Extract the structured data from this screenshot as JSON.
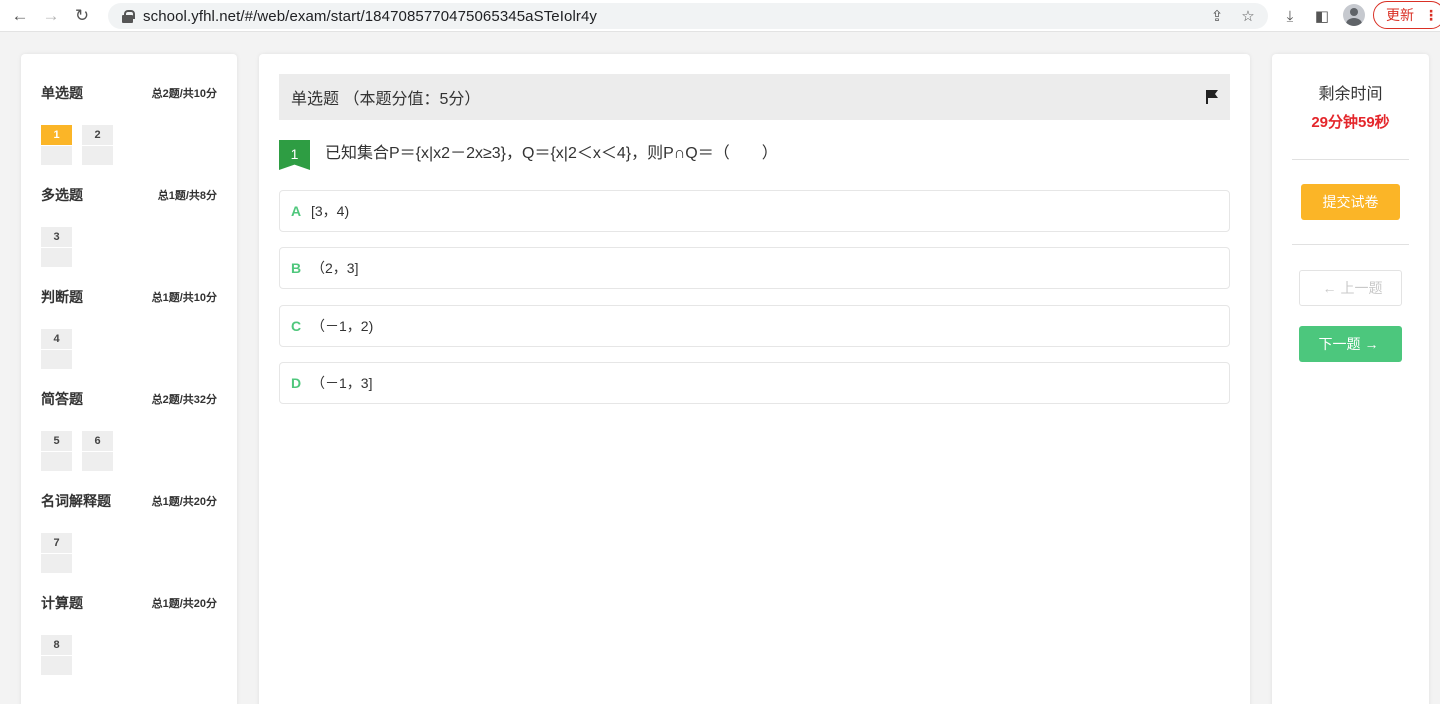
{
  "browser": {
    "url": "school.yfhl.net/#/web/exam/start/1847085770475065345aSTeIolr4y",
    "update_label": "更新",
    "menu_glyph": "⋮"
  },
  "sections": [
    {
      "title": "单选题",
      "summary": "总2题/共10分",
      "questions": [
        "1",
        "2"
      ],
      "active": "1"
    },
    {
      "title": "多选题",
      "summary": "总1题/共8分",
      "questions": [
        "3"
      ]
    },
    {
      "title": "判断题",
      "summary": "总1题/共10分",
      "questions": [
        "4"
      ]
    },
    {
      "title": "简答题",
      "summary": "总2题/共32分",
      "questions": [
        "5",
        "6"
      ]
    },
    {
      "title": "名词解释题",
      "summary": "总1题/共20分",
      "questions": [
        "7"
      ]
    },
    {
      "title": "计算题",
      "summary": "总1题/共20分",
      "questions": [
        "8"
      ]
    }
  ],
  "question": {
    "header": "单选题 （本题分值：5分）",
    "number": "1",
    "stem": "已知集合P＝{x|x2－2x≥3}，Q＝{x|2＜x＜4}，则P∩Q＝（　　）",
    "options": [
      {
        "letter": "A",
        "text": "[3，4)"
      },
      {
        "letter": "B",
        "text": "（2，3]"
      },
      {
        "letter": "C",
        "text": "（－1，2)"
      },
      {
        "letter": "D",
        "text": "（－1，3]"
      }
    ]
  },
  "sidebar_right": {
    "remaining_label": "剩余时间",
    "timer": "29分钟59秒",
    "submit_label": "提交试卷",
    "prev_label": "上一题",
    "next_label": "下一题"
  },
  "colors": {
    "accent_orange": "#fbb527",
    "accent_green": "#4cc77d",
    "badge_green": "#2e9d43",
    "timer_red": "#e4262b"
  }
}
